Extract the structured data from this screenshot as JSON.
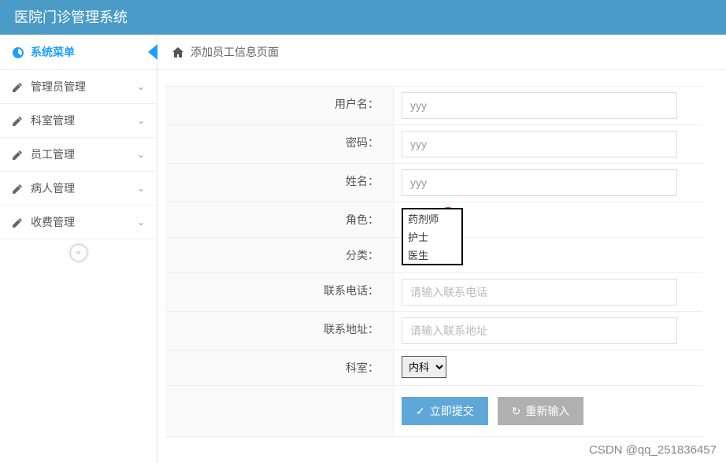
{
  "app": {
    "title": "医院门诊管理系统"
  },
  "sidebar": {
    "header": "系统菜单",
    "items": [
      {
        "label": "管理员管理"
      },
      {
        "label": "科室管理"
      },
      {
        "label": "员工管理"
      },
      {
        "label": "病人管理"
      },
      {
        "label": "收费管理"
      }
    ]
  },
  "breadcrumb": {
    "title": "添加员工信息页面"
  },
  "form": {
    "username": {
      "label": "用户名：",
      "value": "yyy"
    },
    "password": {
      "label": "密码：",
      "value": "yyy"
    },
    "realname": {
      "label": "姓名：",
      "value": "yyy"
    },
    "role": {
      "label": "角色：",
      "options": [
        "药剂师",
        "护士",
        "医生"
      ]
    },
    "category": {
      "label": "分类："
    },
    "phone": {
      "label": "联系电话：",
      "placeholder": "请输入联系电话"
    },
    "address": {
      "label": "联系地址：",
      "placeholder": "请输入联系地址"
    },
    "dept": {
      "label": "科室：",
      "selected": "内科"
    },
    "submit": "立即提交",
    "reset": "重新输入"
  },
  "watermark": "CSDN @qq_251836457"
}
